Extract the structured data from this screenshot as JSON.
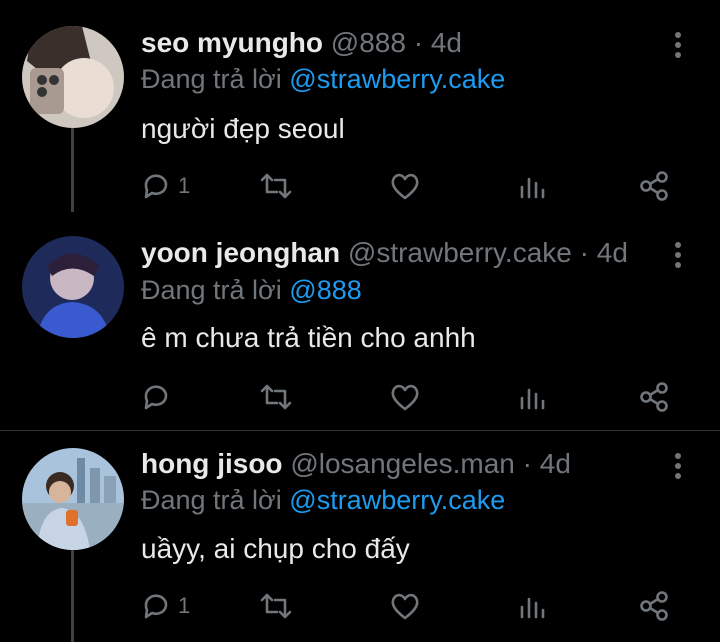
{
  "tweets": [
    {
      "name": "seo myungho",
      "handle": "@888",
      "separator": "·",
      "time": "4d",
      "reply_prefix": "Đang trả lời",
      "reply_to": "@strawberry.cake",
      "text": "người đẹp seoul",
      "reply_count": "1",
      "avatar_colors": [
        "#d9d3cc",
        "#8a7a70"
      ]
    },
    {
      "name": "yoon jeonghan",
      "handle": "@strawberry.cake",
      "separator": "·",
      "time": "4d",
      "reply_prefix": "Đang trả lời",
      "reply_to": "@888",
      "text": "ê m chưa trả tiền cho anhh",
      "reply_count": "",
      "avatar_colors": [
        "#2a2a6a",
        "#4b6bd8"
      ]
    },
    {
      "name": "hong jisoo",
      "handle": "@losangeles.man",
      "separator": "·",
      "time": "4d",
      "reply_prefix": "Đang trả lời",
      "reply_to": "@strawberry.cake",
      "text": "uầyy, ai chụp cho đấy",
      "reply_count": "1",
      "avatar_colors": [
        "#8fb3d6",
        "#d9c7b0"
      ]
    }
  ],
  "icons": [
    "more-vertical-icon",
    "reply-icon",
    "retweet-icon",
    "like-icon",
    "views-icon",
    "share-icon"
  ],
  "colors": {
    "background": "#000000",
    "text": "#e7e9ea",
    "muted": "#71767b",
    "accent": "#1d9bf0",
    "divider": "#2f3336"
  }
}
